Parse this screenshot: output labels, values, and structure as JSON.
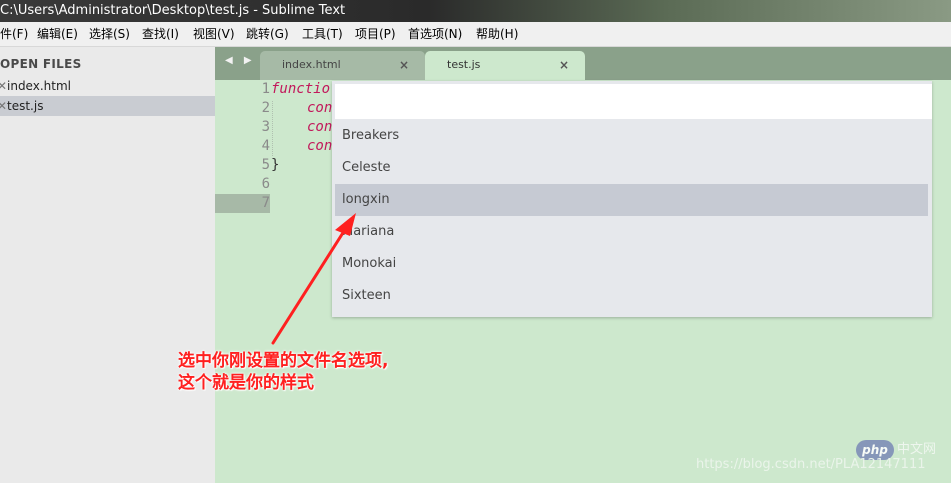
{
  "window": {
    "title": "C:\\Users\\Administrator\\Desktop\\test.js - Sublime Text"
  },
  "menu": [
    "件(F)",
    "编辑(E)",
    "选择(S)",
    "查找(I)",
    "视图(V)",
    "跳转(G)",
    "工具(T)",
    "项目(P)",
    "首选项(N)",
    "帮助(H)"
  ],
  "sidebar": {
    "title": "OPEN FILES",
    "files": [
      {
        "name": "index.html",
        "active": false
      },
      {
        "name": "test.js",
        "active": true
      }
    ]
  },
  "tabs": [
    {
      "label": "index.html",
      "active": false,
      "close": "×"
    },
    {
      "label": "test.js",
      "active": true,
      "close": "×"
    }
  ],
  "nav_arrows": "◀ ▶",
  "editor": {
    "line_numbers": [
      "1",
      "2",
      "3",
      "4",
      "5",
      "6",
      "7"
    ],
    "current_line": "7",
    "lines": [
      {
        "kw": "functio",
        "rest": ""
      },
      {
        "kw": "con",
        "rest": ""
      },
      {
        "kw": "con",
        "rest": ""
      },
      {
        "kw": "con",
        "rest": ""
      },
      {
        "kw": "",
        "rest": "}"
      },
      {
        "kw": "",
        "rest": ""
      },
      {
        "kw": "",
        "rest": ""
      }
    ]
  },
  "quick_panel": {
    "input_value": "",
    "items": [
      "Breakers",
      "Celeste",
      "longxin",
      "Mariana",
      "Monokai",
      "Sixteen"
    ],
    "selected": "longxin"
  },
  "annotation": {
    "line1": "选中你刚设置的文件名选项,",
    "line2": "这个就是你的样式",
    "color": "#ff2020"
  },
  "watermark": {
    "logo": "php",
    "cn": "中文网",
    "url": "https://blog.csdn.net/PLA12147111"
  },
  "colors": {
    "editor_bg": "#cde8cd",
    "tabbar_bg": "#8aa18a",
    "sidebar_bg": "#eaeaea",
    "selected_item_bg": "#c6cad3",
    "keyword": "#c2185b"
  }
}
